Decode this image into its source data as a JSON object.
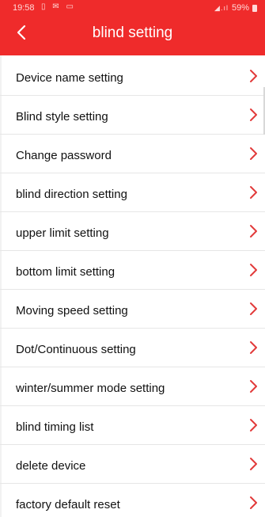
{
  "status_bar": {
    "time": "19:58",
    "left_icons": "▯ ✉ ▭",
    "signal": "◢.ıl",
    "battery_percent": "59%"
  },
  "header": {
    "title": "blind setting",
    "back_icon": "chevron-left-icon"
  },
  "colors": {
    "header_bg": "#ef2b2b",
    "chevron": "#e23a3a",
    "text": "#111111",
    "divider": "#e6e6e6"
  },
  "menu": {
    "items": [
      {
        "label": "Device name setting"
      },
      {
        "label": "Blind style setting"
      },
      {
        "label": "Change password"
      },
      {
        "label": "blind direction setting"
      },
      {
        "label": "upper limit setting"
      },
      {
        "label": "bottom limit setting"
      },
      {
        "label": "Moving speed setting"
      },
      {
        "label": "Dot/Continuous setting"
      },
      {
        "label": "winter/summer mode setting"
      },
      {
        "label": "blind timing list"
      },
      {
        "label": "delete device"
      },
      {
        "label": "factory default reset"
      }
    ]
  }
}
